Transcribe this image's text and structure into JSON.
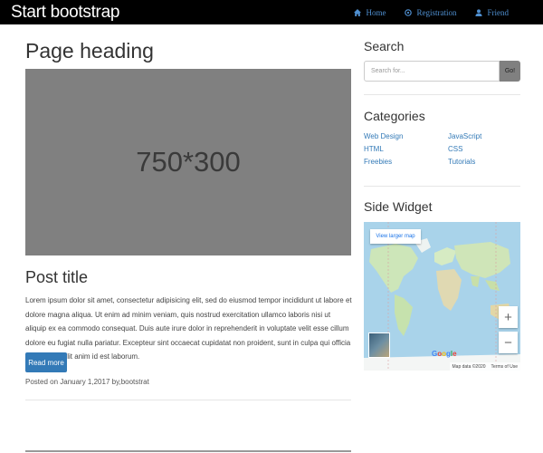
{
  "navbar": {
    "brand": "Start bootstrap",
    "links": [
      {
        "label": "Home",
        "icon": "home-icon"
      },
      {
        "label": "Registration",
        "icon": "registration-icon"
      },
      {
        "label": "Friend",
        "icon": "user-icon"
      }
    ],
    "link_color": "#4f8fd0"
  },
  "main": {
    "page_heading": "Page heading",
    "image_placeholder": "750*300",
    "post": {
      "title": "Post title",
      "body": "Lorem ipsum dolor sit amet, consectetur adipisicing elit, sed do eiusmod tempor incididunt ut labore et dolore magna aliqua. Ut enim ad minim veniam, quis nostrud exercitation ullamco laboris nisi ut aliquip ex ea commodo consequat. Duis aute irure dolor in reprehenderit in voluptate velit esse cillum dolore eu fugiat nulla pariatur. Excepteur sint occaecat cupidatat non proident, sunt in culpa qui officia deserunt mollit anim id est laborum.",
      "read_more": "Read more",
      "meta": "Posted on January 1,2017 by,bootstrat"
    }
  },
  "sidebar": {
    "search": {
      "title": "Search",
      "placeholder": "Search for...",
      "button": "Go!"
    },
    "categories": {
      "title": "Categories",
      "left": [
        "Web Design",
        "HTML",
        "Freebies"
      ],
      "right": [
        "JavaScript",
        "CSS",
        "Tutorials"
      ]
    },
    "widget": {
      "title": "Side Widget",
      "map_link": "View larger map",
      "zoom_in": "+",
      "zoom_out": "−",
      "attribution": "Map data ©2020",
      "terms": "Terms of Use",
      "logo": "Google"
    }
  },
  "colors": {
    "navbar_bg": "#000000",
    "accent": "#337ab7",
    "placeholder_gray": "#808080"
  }
}
